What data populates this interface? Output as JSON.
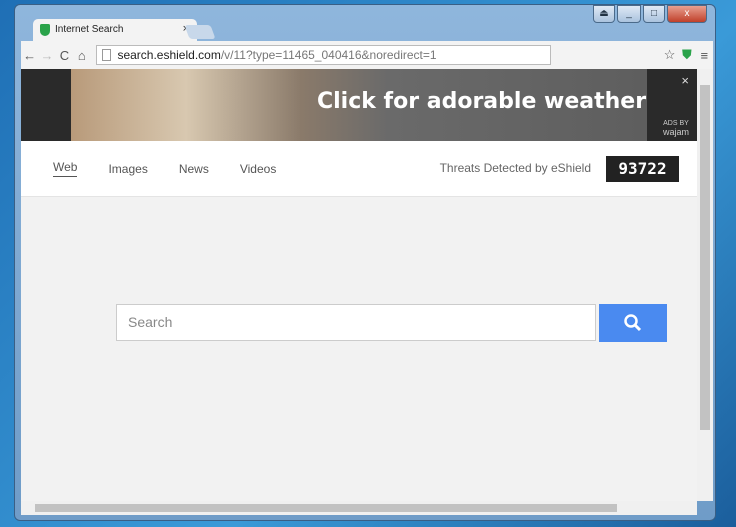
{
  "browser": {
    "tab_title": "Internet Search",
    "url_host": "search.eshield.com",
    "url_path": "/v/11?type=11465_040416&noredirect=1"
  },
  "ad": {
    "text": "Click for adorable weather",
    "ads_by": "ADS BY",
    "brand": "wajam",
    "close": "×"
  },
  "nav": {
    "items": [
      {
        "label": "Web",
        "active": true
      },
      {
        "label": "Images"
      },
      {
        "label": "News"
      },
      {
        "label": "Videos"
      }
    ]
  },
  "threats": {
    "label": "Threats Detected by eShield",
    "count": "93722"
  },
  "search": {
    "placeholder": "Search"
  },
  "colors": {
    "search_button": "#4a8af0",
    "shield": "#2aa34a"
  }
}
